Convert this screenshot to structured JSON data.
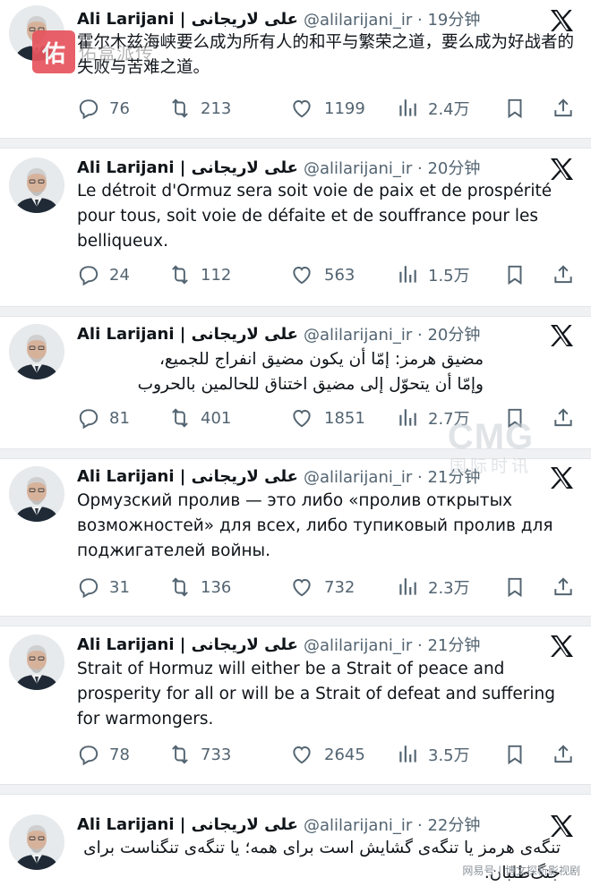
{
  "tweets": [
    {
      "name": "Ali Larijani | علی لاریجانی",
      "handle": "@alilarijani_ir · 19分钟",
      "text": "霍尔木兹海峡要么成为所有人的和平与繁荣之道，要么成为好战者的失败与苦难之道。",
      "rtl": false,
      "replies": "76",
      "reposts": "213",
      "likes": "1199",
      "views": "2.4万"
    },
    {
      "name": "Ali Larijani | علی لاریجانی",
      "handle": "@alilarijani_ir · 20分钟",
      "text": "Le détroit d'Ormuz sera soit voie de paix et de prospérité pour tous, soit voie de défaite et de souffrance pour les belliqueux.",
      "rtl": false,
      "replies": "24",
      "reposts": "112",
      "likes": "563",
      "views": "1.5万"
    },
    {
      "name": "Ali Larijani | علی لاریجانی",
      "handle": "@alilarijani_ir · 20分钟",
      "text": "مضيق هرمز: إمّا أن يكون مضيق انفراج للجميع،\nوإمّا أن يتحوّل إلى مضيق اختناق للحالمين بالحروب",
      "rtl": true,
      "replies": "81",
      "reposts": "401",
      "likes": "1851",
      "views": "2.7万"
    },
    {
      "name": "Ali Larijani | علی لاریجانی",
      "handle": "@alilarijani_ir · 21分钟",
      "text": "Ормузский пролив — это либо «пролив открытых возможностей» для всех, либо тупиковый пролив для поджигателей войны.",
      "rtl": false,
      "replies": "31",
      "reposts": "136",
      "likes": "732",
      "views": "2.3万"
    },
    {
      "name": "Ali Larijani | علی لاریجانی",
      "handle": "@alilarijani_ir · 21分钟",
      "text": "Strait of Hormuz will either be a Strait of peace and prosperity for all or will be a Strait of defeat and suffering for warmongers.",
      "rtl": false,
      "replies": "78",
      "reposts": "733",
      "likes": "2645",
      "views": "3.5万"
    },
    {
      "name": "Ali Larijani | علی لاریجانی",
      "handle": "@alilarijani_ir · 22分钟",
      "text": "تنگه‌ی هرمز یا تنگه‌ی گشایش است برای همه؛ یا تنگه‌ی تنگناست برای جنگ‌طلبان.",
      "rtl": true,
      "replies": "",
      "reposts": "",
      "likes": "",
      "views": ""
    }
  ],
  "overlay": {
    "badge": "佑",
    "badge_text": "佑盒派传",
    "watermark_big": "CMG",
    "watermark_small": "国际时讯",
    "source": "网易号 | 博文探析影视剧"
  },
  "colors": {
    "text": "#0f1419",
    "muted": "#536471",
    "separator": "#eff1f3",
    "badge": "#e7545e"
  },
  "icons": [
    "reply-icon",
    "repost-icon",
    "like-icon",
    "views-icon",
    "bookmark-icon",
    "share-icon",
    "x-logo-icon"
  ]
}
